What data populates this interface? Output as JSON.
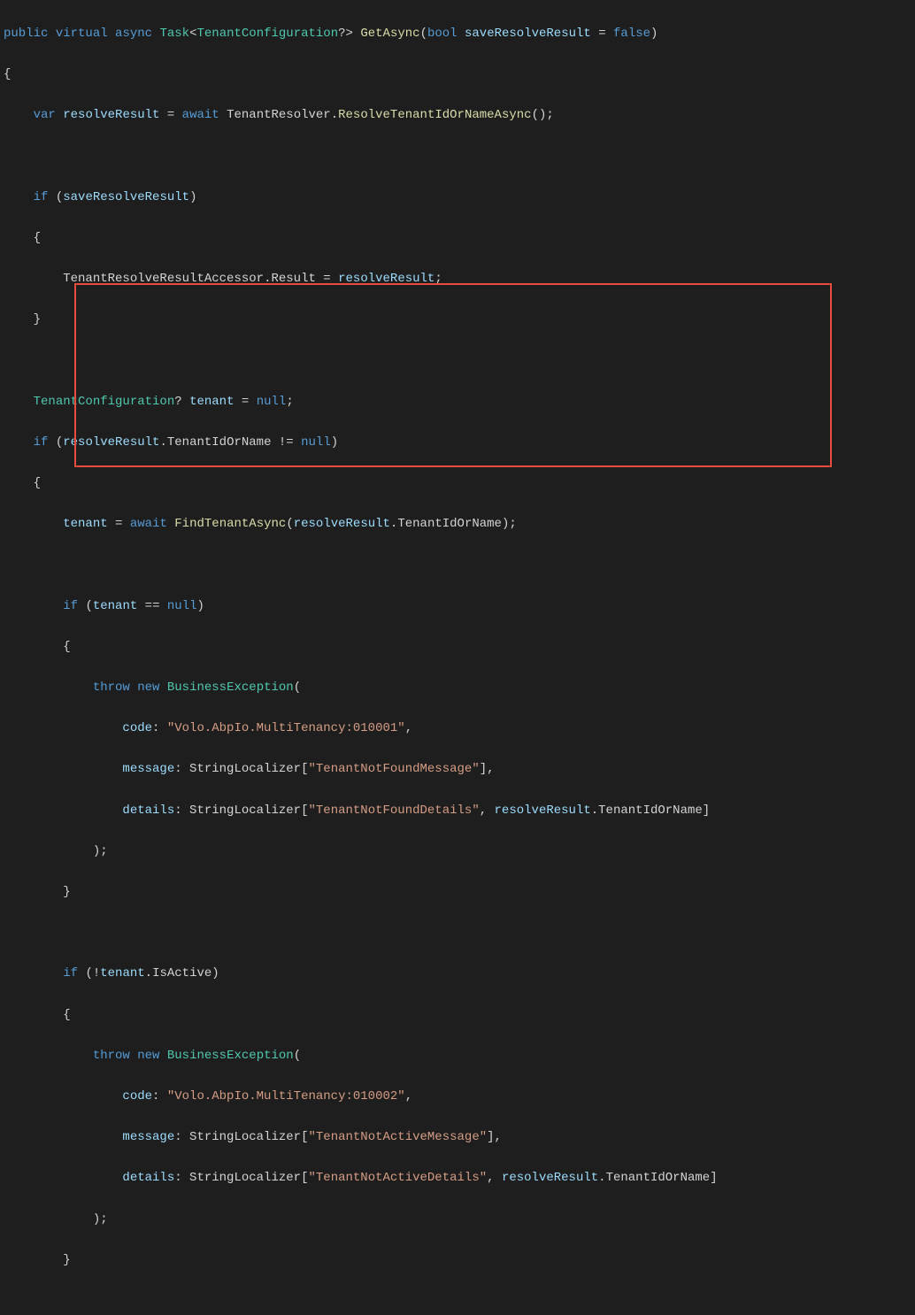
{
  "code": {
    "l1": {
      "kw1": "public",
      "kw2": "virtual",
      "kw3": "async",
      "type1": "Task",
      "type2": "TenantConfiguration",
      "fn": "GetAsync",
      "kw4": "bool",
      "param": "saveResolveResult",
      "kw5": "false"
    },
    "l4": {
      "kw": "var",
      "id": "resolveResult",
      "kw2": "await",
      "obj": "TenantResolver",
      "fn": "ResolveTenantIdOrNameAsync"
    },
    "l6": {
      "kw": "if",
      "id": "saveResolveResult"
    },
    "l8": {
      "obj": "TenantResolveResultAccessor",
      "prop": "Result",
      "id": "resolveResult"
    },
    "l11": {
      "type": "TenantConfiguration",
      "id": "tenant",
      "kw": "null"
    },
    "l12": {
      "kw": "if",
      "id": "resolveResult",
      "prop": "TenantIdOrName",
      "kw2": "null"
    },
    "l14": {
      "id": "tenant",
      "kw": "await",
      "fn": "FindTenantAsync",
      "id2": "resolveResult",
      "prop": "TenantIdOrName"
    },
    "l16": {
      "kw": "if",
      "id": "tenant",
      "kw2": "null"
    },
    "l18": {
      "kw1": "throw",
      "kw2": "new",
      "type": "BusinessException"
    },
    "l19": {
      "param": "code",
      "str": "\"Volo.AbpIo.MultiTenancy:010001\""
    },
    "l20": {
      "param": "message",
      "obj": "StringLocalizer",
      "str": "\"TenantNotFoundMessage\""
    },
    "l21": {
      "param": "details",
      "obj": "StringLocalizer",
      "str": "\"TenantNotFoundDetails\"",
      "id": "resolveResult",
      "prop": "TenantIdOrName"
    },
    "l25": {
      "kw": "if",
      "id": "tenant",
      "prop": "IsActive"
    },
    "l27": {
      "kw1": "throw",
      "kw2": "new",
      "type": "BusinessException"
    },
    "l28": {
      "param": "code",
      "str": "\"Volo.AbpIo.MultiTenancy:010002\""
    },
    "l29": {
      "param": "message",
      "obj": "StringLocalizer",
      "str": "\"TenantNotActiveMessage\""
    },
    "l30": {
      "param": "details",
      "obj": "StringLocalizer",
      "str": "\"TenantNotActiveDetails\"",
      "id": "resolveResult",
      "prop": "TenantIdOrName"
    }
  }
}
